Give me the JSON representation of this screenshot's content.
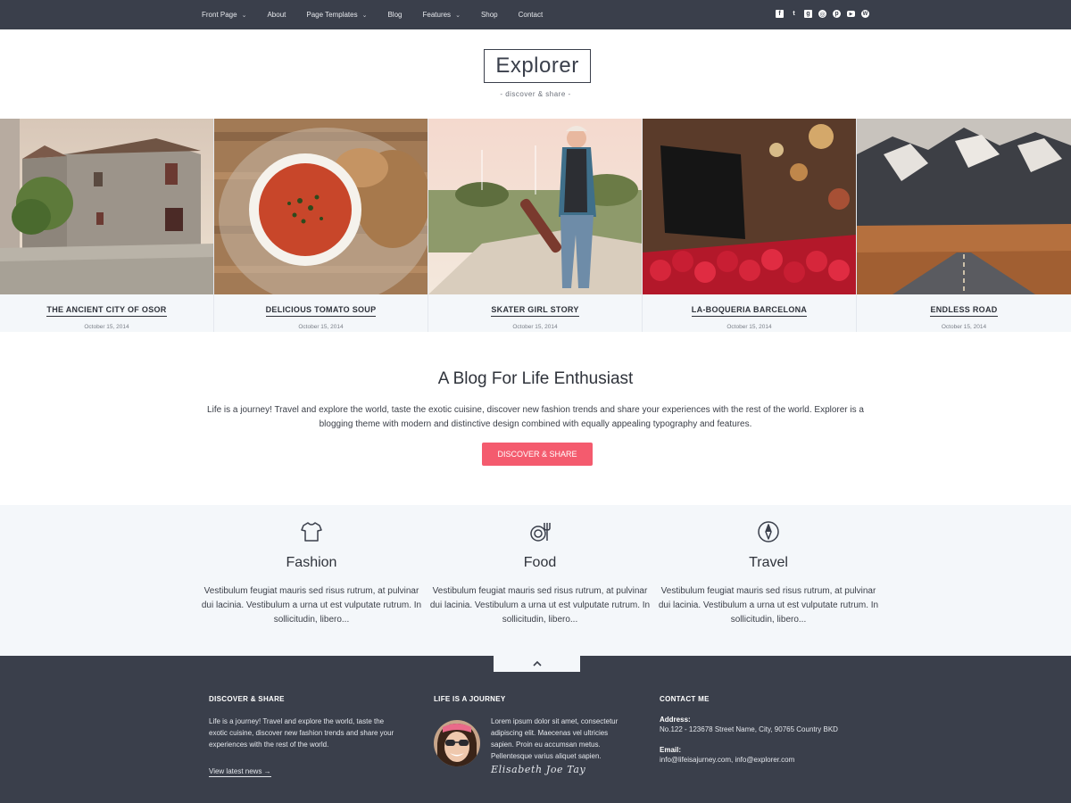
{
  "nav": {
    "items": [
      {
        "label": "Front Page",
        "dropdown": true
      },
      {
        "label": "About",
        "dropdown": false
      },
      {
        "label": "Page Templates",
        "dropdown": true
      },
      {
        "label": "Blog",
        "dropdown": false
      },
      {
        "label": "Features",
        "dropdown": true
      },
      {
        "label": "Shop",
        "dropdown": false
      },
      {
        "label": "Contact",
        "dropdown": false
      }
    ],
    "dropdown_glyph": "⌄",
    "social": [
      {
        "icon": "facebook-icon",
        "glyph": "f"
      },
      {
        "icon": "twitter-icon",
        "glyph": "t"
      },
      {
        "icon": "google-plus-icon",
        "glyph": "g"
      },
      {
        "icon": "dribbble-icon",
        "glyph": "◎"
      },
      {
        "icon": "pinterest-icon",
        "glyph": "p"
      },
      {
        "icon": "youtube-icon",
        "glyph": "▶"
      },
      {
        "icon": "wordpress-icon",
        "glyph": "W"
      }
    ]
  },
  "header": {
    "logo": "Explorer",
    "tagline": "- discover & share -"
  },
  "featured": [
    {
      "title": "THE ANCIENT CITY OF OSOR",
      "date": "October 15, 2014"
    },
    {
      "title": "DELICIOUS TOMATO SOUP",
      "date": "October 15, 2014"
    },
    {
      "title": "SKATER GIRL STORY",
      "date": "October 15, 2014"
    },
    {
      "title": "LA-BOQUERIA BARCELONA",
      "date": "October 15, 2014"
    },
    {
      "title": "ENDLESS ROAD",
      "date": "October 15, 2014"
    }
  ],
  "intro": {
    "title": "A Blog For Life Enthusiast",
    "text": "Life is a journey! Travel and explore the world, taste the exotic cuisine, discover new fashion trends and share your experiences with the rest of the world. Explorer is a blogging theme with modern and distinctive design combined with equally appealing typography and features.",
    "button": "DISCOVER & SHARE"
  },
  "features": [
    {
      "name": "Fashion",
      "icon": "tshirt-icon",
      "text": "Vestibulum feugiat mauris sed risus rutrum, at pulvinar dui lacinia. Vestibulum a urna ut est vulputate rutrum. In sollicitudin, libero..."
    },
    {
      "name": "Food",
      "icon": "plate-fork-icon",
      "text": "Vestibulum feugiat mauris sed risus rutrum, at pulvinar dui lacinia. Vestibulum a urna ut est vulputate rutrum. In sollicitudin, libero..."
    },
    {
      "name": "Travel",
      "icon": "compass-icon",
      "text": "Vestibulum feugiat mauris sed risus rutrum, at pulvinar dui lacinia. Vestibulum a urna ut est vulputate rutrum. In sollicitudin, libero..."
    }
  ],
  "footer": {
    "col1": {
      "heading": "DISCOVER & SHARE",
      "lines": [
        "Life is a journey! Travel and explore the world, taste the",
        "exotic cuisine, discover new fashion trends and share your",
        "experiences with the rest of the world."
      ],
      "link": "View latest news →"
    },
    "col2": {
      "heading": "LIFE IS A JOURNEY",
      "lines": [
        "Lorem ipsum dolor sit amet, consectetur",
        "adipiscing elit. Maecenas vel ultricies",
        "sapien. Proin eu accumsan metus.",
        "Pellentesque varius aliquet sapien."
      ],
      "signature": "Elisabeth Joe Tay"
    },
    "col3": {
      "heading": "CONTACT ME",
      "address_label": "Address:",
      "address": "No.122 - 123678 Street Name, City, 90765 Country BKD",
      "email_label": "Email:",
      "email": "info@lifeisajurney.com, info@explorer.com"
    }
  },
  "colors": {
    "nav_bg": "#3a3f4b",
    "accent": "#f45b6e",
    "light_bg": "#f4f7fa"
  }
}
